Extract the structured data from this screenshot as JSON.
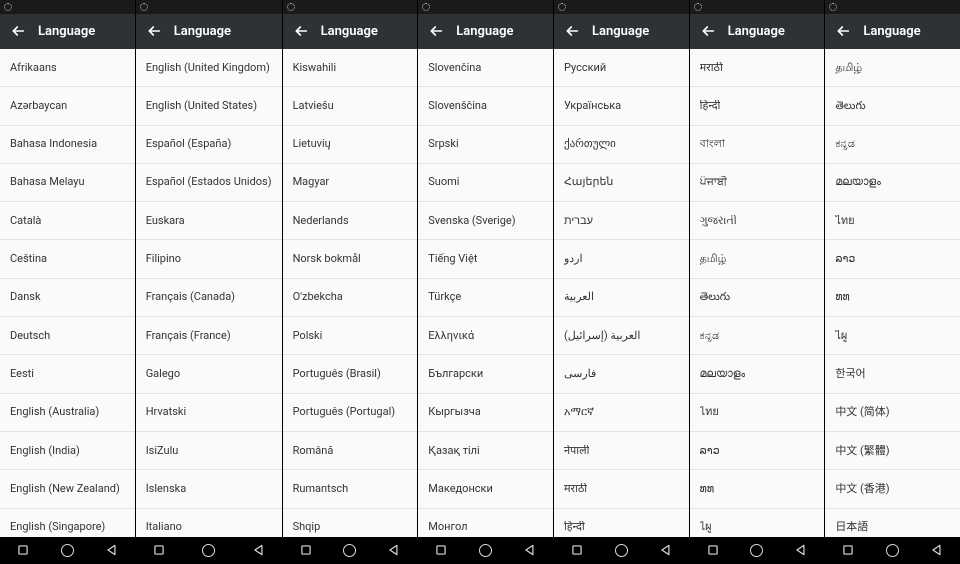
{
  "appbar_title": "Language",
  "panels": [
    {
      "items": [
        "Afrikaans",
        "Azərbaycan",
        "Bahasa Indonesia",
        "Bahasa Melayu",
        "Català",
        "Čeština",
        "Dansk",
        "Deutsch",
        "Eesti",
        "English (Australia)",
        "English (India)",
        "English (New Zealand)",
        "English (Singapore)"
      ]
    },
    {
      "items": [
        "English (United Kingdom)",
        "English (United States)",
        "Español (España)",
        "Español (Estados Unidos)",
        "Euskara",
        "Filipino",
        "Français (Canada)",
        "Français (France)",
        "Galego",
        "Hrvatski",
        "IsiZulu",
        "Íslenska",
        "Italiano"
      ]
    },
    {
      "items": [
        "Kiswahili",
        "Latviešu",
        "Lietuvių",
        "Magyar",
        "Nederlands",
        "Norsk bokmål",
        "O'zbekcha",
        "Polski",
        "Português (Brasil)",
        "Português (Portugal)",
        "Română",
        "Rumantsch",
        "Shqip"
      ]
    },
    {
      "items": [
        "Slovenčina",
        "Slovenščina",
        "Srpski",
        "Suomi",
        "Svenska (Sverige)",
        "Tiếng Việt",
        "Türkçe",
        "Ελληνικά",
        "Български",
        "Кыргызча",
        "Қазақ тілі",
        "Македонски",
        "Монгол"
      ]
    },
    {
      "items": [
        "Русский",
        "Українська",
        "ქართული",
        "Հայերեն",
        "עברית",
        "اردو",
        "العربية",
        "العربية (إسرائيل)",
        "فارسی",
        "አማርኛ",
        "नेपाली",
        "मराठी",
        "हिन्दी"
      ]
    },
    {
      "items": [
        "मराठी",
        "हिन्दी",
        "বাংলা",
        "ਪੰਜਾਬੀ",
        "ગુજરાતી",
        "தமிழ்",
        "తెలుగు",
        "ಕನ್ನಡ",
        "മലയാളം",
        "ไทย",
        "ລາວ",
        "ທທ",
        "ไผู"
      ]
    },
    {
      "items": [
        "தமிழ்",
        "తెలుగు",
        "ಕನ್ನಡ",
        "മലയാളം",
        "ไทย",
        "ລາວ",
        "ທທ",
        "ไผู",
        "한국어",
        "中文 (简体)",
        "中文 (繁體)",
        "中文 (香港)",
        "日本語"
      ]
    }
  ]
}
